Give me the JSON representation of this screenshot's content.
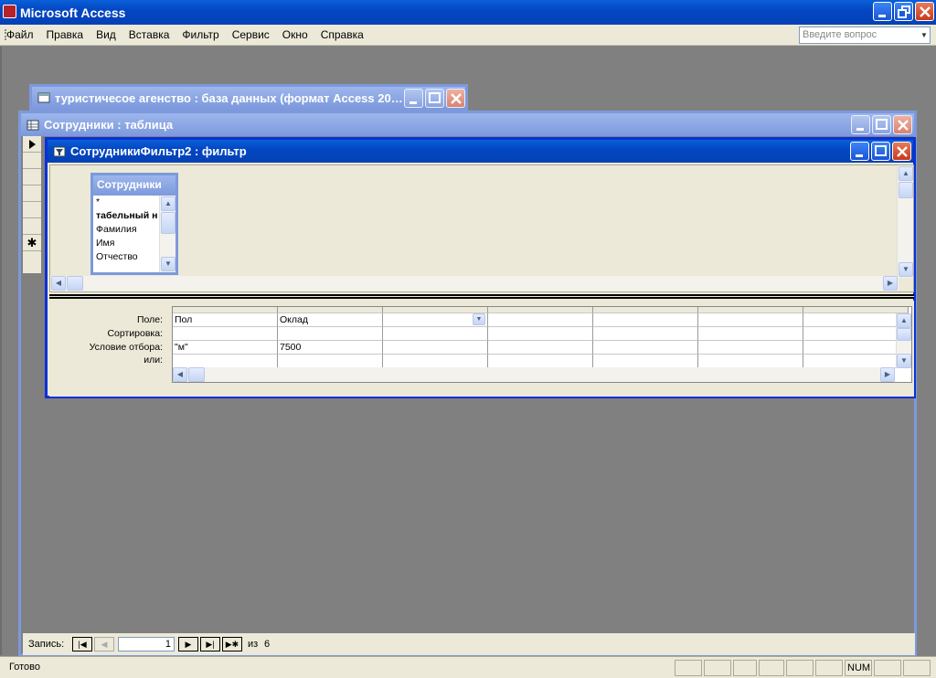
{
  "app": {
    "title": "Microsoft Access"
  },
  "menu": {
    "items": [
      "Файл",
      "Правка",
      "Вид",
      "Вставка",
      "Фильтр",
      "Сервис",
      "Окно",
      "Справка"
    ]
  },
  "ask": {
    "placeholder": "Введите вопрос"
  },
  "db_window": {
    "title": "туристичесое агенство : база данных (формат Access 20…"
  },
  "table_window": {
    "title": "Сотрудники : таблица"
  },
  "filter_window": {
    "title": "СотрудникиФильтр2 : фильтр",
    "field_list": {
      "title": "Сотрудники",
      "fields": [
        "*",
        "табельный н",
        "Фамилия",
        "Имя",
        "Отчество"
      ]
    },
    "grid": {
      "row_labels": [
        "Поле:",
        "Сортировка:",
        "Условие отбора:",
        "или:"
      ],
      "columns": [
        {
          "field": "Пол",
          "sort": "",
          "criteria": "\"м\"",
          "or": ""
        },
        {
          "field": "Оклад",
          "sort": "",
          "criteria": "7500",
          "or": ""
        },
        {
          "field": "",
          "sort": "",
          "criteria": "",
          "or": ""
        },
        {
          "field": "",
          "sort": "",
          "criteria": "",
          "or": ""
        },
        {
          "field": "",
          "sort": "",
          "criteria": "",
          "or": ""
        },
        {
          "field": "",
          "sort": "",
          "criteria": "",
          "or": ""
        },
        {
          "field": "",
          "sort": "",
          "criteria": "",
          "or": ""
        }
      ]
    }
  },
  "record_nav": {
    "label": "Запись:",
    "current": "1",
    "of_label": "из",
    "total": "6"
  },
  "status": {
    "text": "Готово",
    "num": "NUM"
  }
}
